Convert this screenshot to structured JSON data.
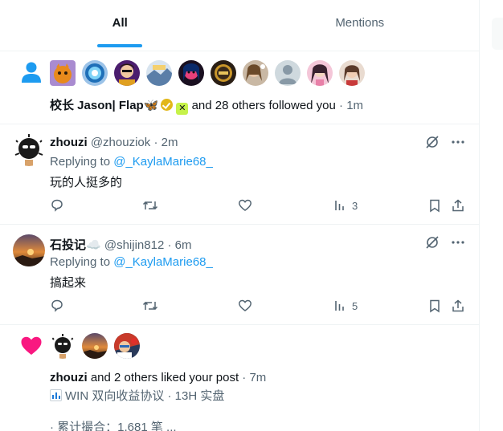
{
  "tabs": [
    {
      "label": "All",
      "active": true
    },
    {
      "label": "Mentions",
      "active": false
    }
  ],
  "follow_notification": {
    "names": "校长 Jason| Flap🦋",
    "others": "and 28 others followed you",
    "time": "· 1m",
    "avatar_count": 10
  },
  "tweets": [
    {
      "name": "zhouzi",
      "handle": "@zhouziok",
      "time": "· 2m",
      "replying_prefix": "Replying to",
      "replying_to": "@_KaylaMarie68_",
      "body": "玩的人挺多的",
      "views": "3"
    },
    {
      "name": "石投记☁️",
      "handle": "@shijin812",
      "time": "· 6m",
      "replying_prefix": "Replying to",
      "replying_to": "@_KaylaMarie68_",
      "body": "搞起来",
      "views": "5"
    }
  ],
  "like_notification": {
    "name": "zhouzi",
    "text": "and 2 others liked your post",
    "time": "· 7m",
    "post_line1": "WIN 双向收益协议 · 13H 实盘",
    "post_line2": "· 累计撮合：1,681 笔 ..."
  },
  "colors": {
    "accent": "#1d9bf0",
    "like": "#f91880",
    "muted": "#536471",
    "text": "#0f1419"
  },
  "icons": [
    "person-icon",
    "heart-icon",
    "reply-icon",
    "retweet-icon",
    "like-icon",
    "views-icon",
    "bookmark-icon",
    "share-icon",
    "grok-icon",
    "more-icon"
  ]
}
